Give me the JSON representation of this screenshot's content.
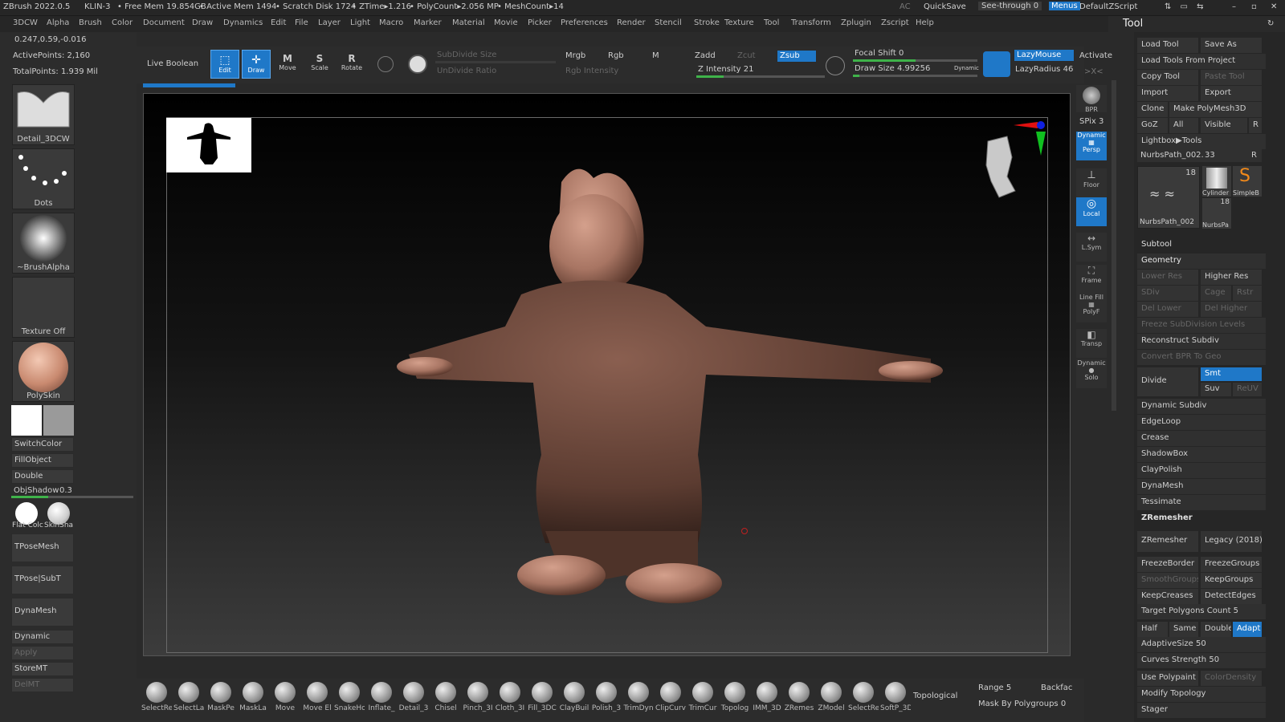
{
  "titlebar": {
    "app": "ZBrush 2022.0.5",
    "user": "KLIN-3",
    "freemem": "• Free Mem 19.854GB",
    "activemem": "• Active Mem 1494",
    "scratch": "• Scratch Disk 1724",
    "ztime": "• ZTime▸1.216",
    "polycount": "• PolyCount▸2.056 MP",
    "meshcount": "• MeshCount▸14",
    "ac": "AC",
    "quicksave": "QuickSave",
    "seethrough": "See-through  0",
    "menus": "Menus",
    "script": "DefaultZScript"
  },
  "menubar": [
    "3DCW",
    "Alpha",
    "Brush",
    "Color",
    "Document",
    "Draw",
    "Dynamics",
    "Edit",
    "File",
    "Layer",
    "Light",
    "Macro",
    "Marker",
    "Material",
    "Movie",
    "Picker",
    "Preferences",
    "Render",
    "Stencil",
    "Stroke",
    "Texture",
    "Tool",
    "Transform",
    "Zplugin",
    "Zscript",
    "Help"
  ],
  "left": {
    "coords": "0.247,0.59,-0.016",
    "activepoints": "ActivePoints: 2,160",
    "totalpoints": "TotalPoints: 1.939 Mil",
    "brush": "Detail_3DCW",
    "stroke": "Dots",
    "alpha": "~BrushAlpha",
    "texture": "Texture Off",
    "material": "PolySkin",
    "switchcolor": "SwitchColor",
    "fillobject": "FillObject",
    "double": "Double",
    "objshadow": "ObjShadow",
    "objshadow_val": "0.3",
    "objshadow_level": 0.3,
    "mat1": "Flat Colc",
    "mat2": "SkinSha",
    "tposemesh": "TPoseMesh",
    "tposesubt": "TPose|SubT",
    "dynamesh": "DynaMesh",
    "dynamic": "Dynamic",
    "apply": "Apply",
    "storemt": "StoreMT",
    "delmt": "DelMT"
  },
  "toolbar": {
    "liveboolean": "Live Boolean",
    "edit": "Edit",
    "draw": "Draw",
    "move": "Move",
    "scale": "Scale",
    "rotate": "Rotate",
    "subdivsize": "SubDivide Size",
    "undivide": "UnDivide Ratio",
    "mrgb": "Mrgb",
    "rgb": "Rgb",
    "m": "M",
    "rgbint": "Rgb Intensity",
    "zadd": "Zadd",
    "zcut": "Zcut",
    "zsub": "Zsub",
    "zint": "Z Intensity 21",
    "focal": "Focal Shift 0",
    "drawsize": "Draw Size 4.99256",
    "dynamic": "Dynamic",
    "lazymouse": "LazyMouse",
    "lazyradius": "LazyRadius 46",
    "activate": "Activate",
    "xk": ">X<",
    "zint_level": 0.21,
    "focal_level": 0.5,
    "drawsize_level": 0.05
  },
  "rightstrip": {
    "bpr": "BPR",
    "spix": "SPix 3",
    "persp": "Persp",
    "dyn": "Dynamic",
    "floor": "Floor",
    "local": "Local",
    "lsym": "L.Sym",
    "frame": "Frame",
    "linefill": "Line Fill",
    "polyf": "PolyF",
    "transp": "Transp",
    "dynamic2": "Dynamic",
    "solo": "Solo"
  },
  "tool": {
    "title": "Tool",
    "loadtool": "Load Tool",
    "saveas": "Save As",
    "loadfromproject": "Load Tools From Project",
    "copytool": "Copy Tool",
    "pastetool": "Paste Tool",
    "import": "Import",
    "export": "Export",
    "clone": "Clone",
    "makepolymesh": "Make PolyMesh3D",
    "goz": "GoZ",
    "all": "All",
    "visible": "Visible",
    "r": "R",
    "lightbox": "Lightbox▶Tools",
    "nurbs": "NurbsPath_002.",
    "nurbsval": "33",
    "t18a": "18",
    "t18b": "18",
    "cyl": "Cylinder",
    "simple": "SimpleB",
    "nurbs2": "NurbsPath_002",
    "nurbs3": "NurbsPa",
    "subtool": "Subtool",
    "geometry": "Geometry",
    "lowerres": "Lower Res",
    "higherres": "Higher Res",
    "sdiv": "SDiv",
    "cage": "Cage",
    "rstr": "Rstr",
    "dellower": "Del Lower",
    "delhigher": "Del Higher",
    "freeze": "Freeze SubDivision Levels",
    "reconstruct": "Reconstruct Subdiv",
    "convertbpr": "Convert BPR To Geo",
    "divide": "Divide",
    "smt": "Smt",
    "suv": "Suv",
    "reuv": "ReUV",
    "dynsubdiv": "Dynamic Subdiv",
    "edgeloop": "EdgeLoop",
    "crease": "Crease",
    "shadowbox": "ShadowBox",
    "claypolish": "ClayPolish",
    "dynamesh": "DynaMesh",
    "tessimate": "Tessimate",
    "zremesher_h": "ZRemesher",
    "zremesher": "ZRemesher",
    "legacy": "Legacy (2018)",
    "freezeborder": "FreezeBorder",
    "freezegroups": "FreezeGroups",
    "smoothgroups": "SmoothGroups",
    "keepgroups": "KeepGroups",
    "keepcreases": "KeepCreases",
    "detectedges": "DetectEdges",
    "target": "Target Polygons Count 5",
    "half": "Half",
    "same": "Same",
    "double": "Double",
    "adapt": "Adapt",
    "adaptive": "AdaptiveSize 50",
    "curves": "Curves Strength 50",
    "usepolypaint": "Use Polypaint",
    "colordensity": "ColorDensity",
    "modifytopo": "Modify Topology",
    "stager": "Stager"
  },
  "bottom": {
    "brushes": [
      "SelectRe",
      "SelectLa",
      "MaskPe",
      "MaskLa",
      "Move",
      "Move El",
      "SnakeHo",
      "Inflate_",
      "Detail_3",
      "Chisel",
      "Pinch_3I",
      "Cloth_3I",
      "Fill_3DC",
      "ClayBuil",
      "Polish_3",
      "TrimDyn",
      "ClipCurv",
      "TrimCur",
      "Topolog",
      "IMM_3D",
      "ZRemes",
      "ZModel",
      "SelectRe",
      "SoftP_3D"
    ],
    "topological": "Topological",
    "range": "Range 5",
    "backface": "Backfac",
    "maskbypoly": "Mask By Polygroups 0"
  },
  "colors": {
    "accent": "#1f78c8",
    "green": "#3fb34a",
    "skin": "#a87563"
  }
}
